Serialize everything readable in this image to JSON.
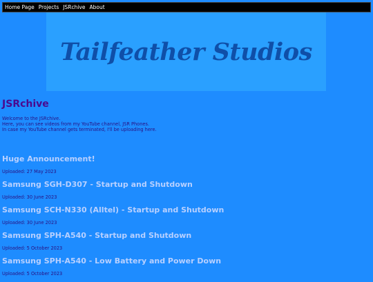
{
  "nav": {
    "items": [
      "Home Page",
      "Projects",
      "JSRchive",
      "About"
    ]
  },
  "banner": {
    "text": "Tailfeather Studios"
  },
  "page": {
    "title": "JSRchive",
    "intro": [
      "Welcome to the JSRchive.",
      "Here, you can see videos from my YouTube channel, JSR Phones.",
      "In case my YouTube channel gets terminated, I'll be uploading here."
    ]
  },
  "videos": [
    {
      "title": "Huge Announcement!",
      "date": "Uploaded: 27 May 2023"
    },
    {
      "title": "Samsung SGH-D307 - Startup and Shutdown",
      "date": "Uploaded: 30 June 2023"
    },
    {
      "title": "Samsung SCH-N330 (Alltel) - Startup and Shutdown",
      "date": "Uploaded: 30 June 2023"
    },
    {
      "title": "Samsung SPH-A540 - Startup and Shutdown",
      "date": "Uploaded: 5 October 2023"
    },
    {
      "title": "Samsung SPH-A540 - Low Battery and Power Down",
      "date": "Uploaded: 5 October 2023"
    }
  ],
  "colors": {
    "background": "#1e8cff",
    "banner": "#2aa0ff",
    "banner_text": "#0f4fa8",
    "title": "#4a0a8f",
    "video_title": "#b8d0ff",
    "navbar": "#000000"
  }
}
